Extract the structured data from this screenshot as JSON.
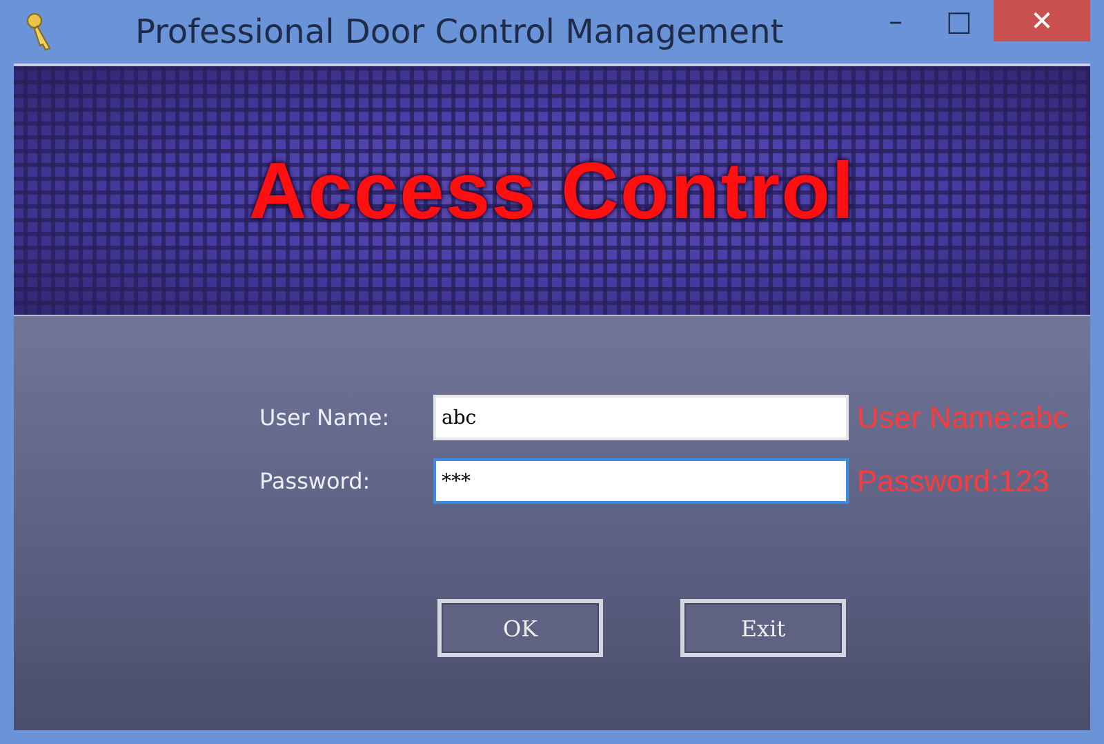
{
  "window": {
    "title": "Professional Door Control Management",
    "controls": [
      "–",
      "□",
      "✕"
    ]
  },
  "banner": {
    "title": "Access Control"
  },
  "form": {
    "fields": [
      {
        "label": "User Name:",
        "value": "abc",
        "focused": false,
        "annotation": "User Name:abc"
      },
      {
        "label": "Password:",
        "value": "***",
        "focused": true,
        "annotation": "Password:123"
      }
    ],
    "buttons": [
      "OK",
      "Exit"
    ]
  }
}
